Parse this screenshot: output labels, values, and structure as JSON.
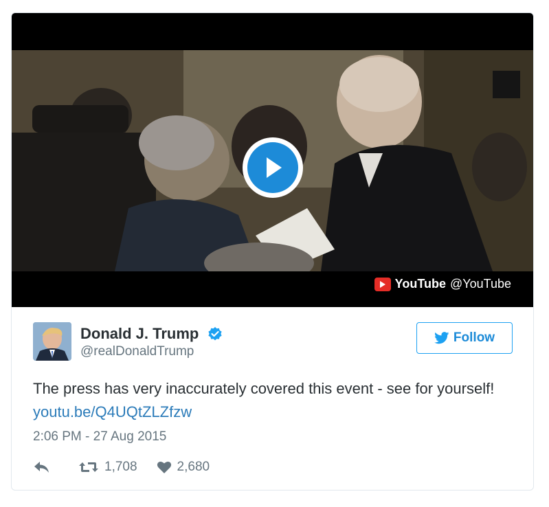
{
  "video": {
    "attribution_brand": "YouTube",
    "attribution_handle": "@YouTube",
    "play_color": "#1d8bd8"
  },
  "tweet": {
    "display_name": "Donald J. Trump",
    "handle": "@realDonaldTrump",
    "verified": true,
    "follow_label": "Follow",
    "text_prefix": "The press has very inaccurately covered this event - see for yourself! ",
    "link_text": "youtu.be/Q4UQtZLZfzw",
    "timestamp": "2:06 PM - 27 Aug 2015",
    "retweets": "1,708",
    "likes": "2,680"
  },
  "icons": {
    "reply": "reply-icon",
    "retweet": "retweet-icon",
    "like": "heart-icon",
    "twitter": "twitter-bird-icon",
    "verified": "verified-badge-icon",
    "play": "play-icon",
    "youtube": "youtube-logo-icon"
  },
  "colors": {
    "accent": "#1da1f2",
    "link": "#2b7bb9",
    "text": "#292f33",
    "muted": "#66757f",
    "youtube_red": "#e52d27"
  }
}
